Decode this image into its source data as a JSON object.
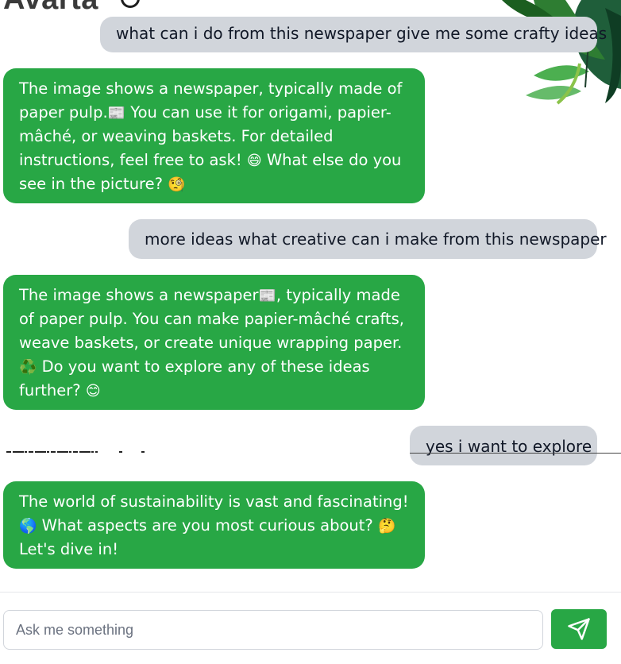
{
  "app": {
    "brand": "Avarta"
  },
  "messages": [
    {
      "role": "user",
      "text": "what can i do from this newspaper give me some crafty ideas"
    },
    {
      "role": "bot",
      "parts": [
        "The image shows a newspaper, typically made of paper pulp.",
        "📰",
        " You can use it for origami, papier-mâché, or weaving baskets. For detailed instructions, feel free to ask! ",
        "😄",
        " What else do you see in the picture? ",
        "🧐"
      ]
    },
    {
      "role": "user",
      "text": "more ideas what creative can i make from this newspaper"
    },
    {
      "role": "bot",
      "parts": [
        "The image shows a newspaper",
        "📰",
        ", typically made of paper pulp. You can make papier-mâché crafts, weave baskets, or create unique wrapping paper. ",
        "♻️",
        " Do you want to explore any of these ideas further? ",
        "😊"
      ]
    },
    {
      "role": "user",
      "text": "yes i want to explore"
    },
    {
      "role": "bot",
      "parts": [
        "The world of sustainability is vast and fascinating! ",
        "🌎",
        " What aspects are you most curious about? ",
        "🤔",
        " Let's dive in!"
      ]
    }
  ],
  "composer": {
    "placeholder": "Ask me something",
    "value": "",
    "send_icon": "send-icon"
  },
  "colors": {
    "bot_bubble": "#28a745",
    "user_bubble": "#d1d5db",
    "send_button": "#28a745"
  }
}
